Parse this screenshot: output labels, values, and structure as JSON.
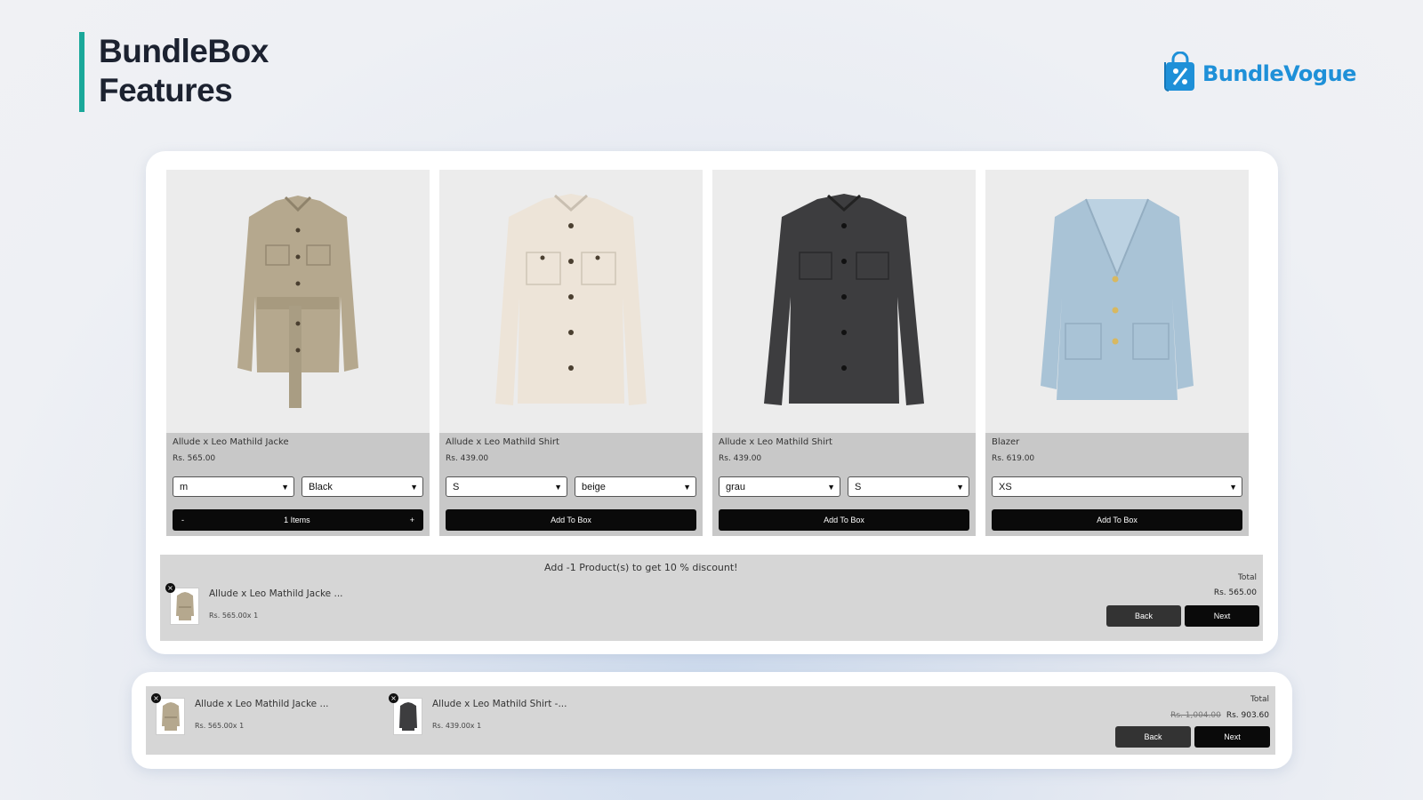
{
  "header": {
    "title_line1": "BundleBox",
    "title_line2": "Features",
    "accent_color": "#1aa89a"
  },
  "brand": {
    "name": "BundleVogue",
    "icon": "shopping-bag-percent-icon",
    "color": "#1e90d8"
  },
  "products": [
    {
      "name": "Allude x Leo Mathild Jacke",
      "price": "Rs. 565.00",
      "options": [
        "m",
        "Black"
      ],
      "action": "stepper",
      "stepper": {
        "minus": "-",
        "label": "1 Items",
        "plus": "+"
      },
      "garment_color": "#b5a88e"
    },
    {
      "name": "Allude x Leo Mathild Shirt",
      "price": "Rs. 439.00",
      "options": [
        "S",
        "beige"
      ],
      "action": "button",
      "button_label": "Add To Box",
      "garment_color": "#ede4d8"
    },
    {
      "name": "Allude x Leo Mathild Shirt",
      "price": "Rs. 439.00",
      "options": [
        "grau",
        "S"
      ],
      "action": "button",
      "button_label": "Add To Box",
      "garment_color": "#3d3d3f"
    },
    {
      "name": "Blazer",
      "price": "Rs. 619.00",
      "options": [
        "XS"
      ],
      "action": "button",
      "button_label": "Add To Box",
      "garment_color": "#a9c3d6"
    }
  ],
  "summary": {
    "message": "Add -1 Product(s) to get 10 % discount!",
    "items": [
      {
        "name": "Allude x Leo Mathild Jacke ...",
        "sub": "Rs. 565.00x 1",
        "remove": "×"
      }
    ],
    "total_label": "Total",
    "total_value": "Rs. 565.00",
    "back_label": "Back",
    "next_label": "Next"
  },
  "bar": {
    "items": [
      {
        "name": "Allude x Leo Mathild Jacke ...",
        "sub": "Rs. 565.00x 1",
        "remove": "×"
      },
      {
        "name": "Allude x Leo Mathild Shirt -...",
        "sub": "Rs. 439.00x 1",
        "remove": "×"
      }
    ],
    "total_label": "Total",
    "original_total": "Rs. 1,004.00",
    "discounted_total": "Rs. 903.60",
    "back_label": "Back",
    "next_label": "Next"
  }
}
